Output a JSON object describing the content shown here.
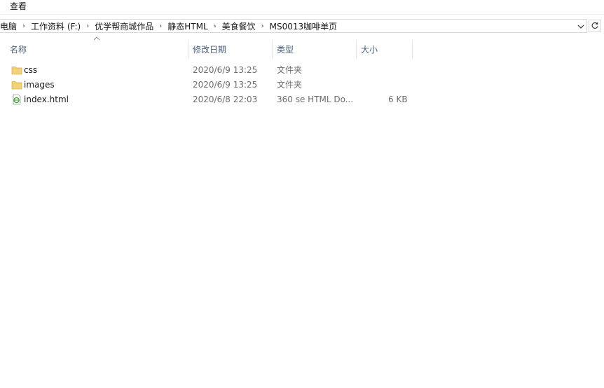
{
  "menu": {
    "view_label": "查看"
  },
  "address": {
    "crumbs": [
      "电脑",
      "工作资料 (F:)",
      "优学帮商城作品",
      "静态HTML",
      "美食餐饮",
      "MS0013咖啡单页"
    ],
    "separator": "›",
    "dropdown_glyph": "⌄",
    "refresh_glyph": "↻"
  },
  "columns": {
    "name": "名称",
    "modified": "修改日期",
    "type": "类型",
    "size": "大小"
  },
  "files": [
    {
      "name": "css",
      "modified": "2020/6/9 13:25",
      "type": "文件夹",
      "size": "",
      "icon": "folder-icon"
    },
    {
      "name": "images",
      "modified": "2020/6/9 13:25",
      "type": "文件夹",
      "size": "",
      "icon": "folder-icon"
    },
    {
      "name": "index.html",
      "modified": "2020/6/8 22:03",
      "type": "360 se HTML Do...",
      "size": "6 KB",
      "icon": "html-file-icon"
    }
  ],
  "colors": {
    "header_text": "#4c607a",
    "folder": "#f3d37a",
    "html_icon": "#4aa83a"
  }
}
